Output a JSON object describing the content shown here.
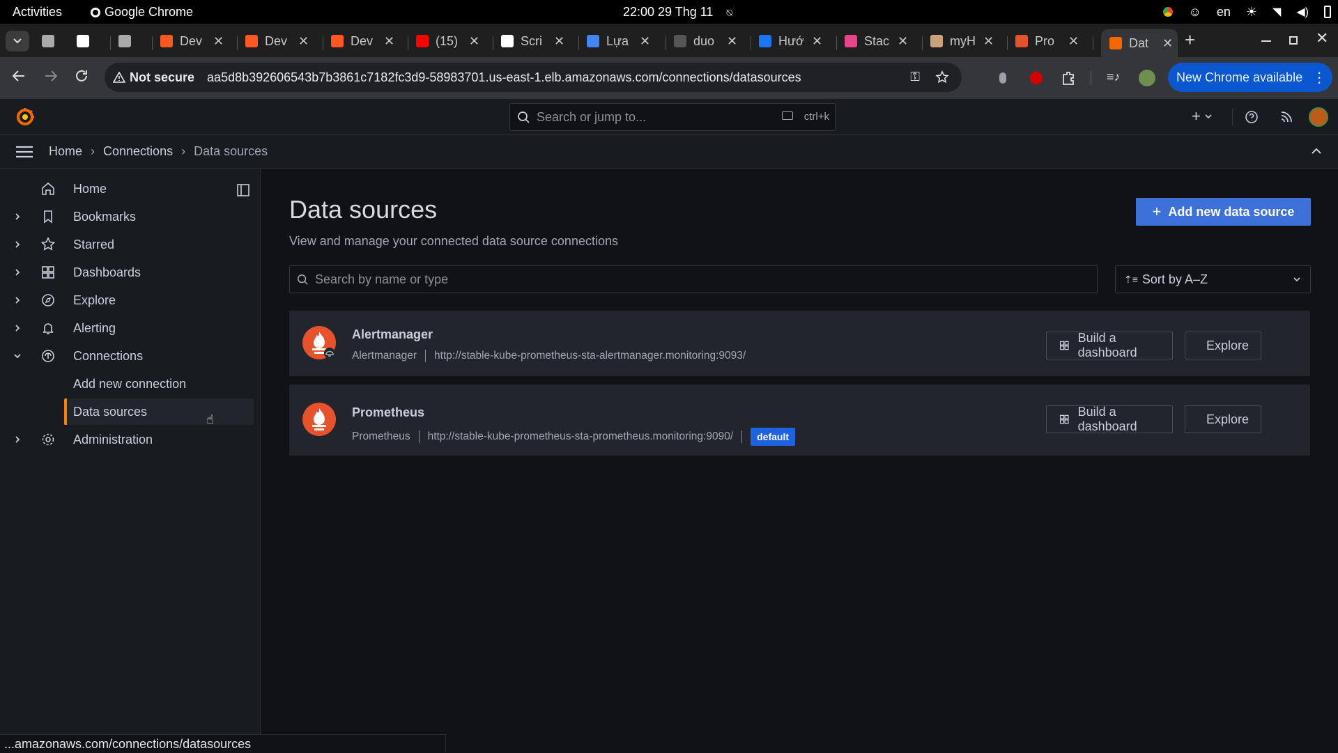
{
  "os": {
    "activities": "Activities",
    "app_name": "Google Chrome",
    "clock": "22:00  29 Thg 11",
    "lang": "en"
  },
  "tabs": [
    {
      "title": "",
      "color": "#aaaaaa"
    },
    {
      "title": "",
      "color": "#ffffff"
    },
    {
      "title": "",
      "color": "#aaaaaa"
    },
    {
      "title": "Dev",
      "color": "#ff5722"
    },
    {
      "title": "Dev",
      "color": "#ff5722"
    },
    {
      "title": "Dev",
      "color": "#ff5722"
    },
    {
      "title": "(15)",
      "color": "#ff0000"
    },
    {
      "title": "Scri",
      "color": "#ffffff"
    },
    {
      "title": "Lựa",
      "color": "#4285f4"
    },
    {
      "title": "duo",
      "color": "#555555"
    },
    {
      "title": "Hướ",
      "color": "#1877f2"
    },
    {
      "title": "Stac",
      "color": "#e8448a"
    },
    {
      "title": "myH",
      "color": "#c9a27a"
    },
    {
      "title": "Pro",
      "color": "#e6522c"
    },
    {
      "title": "Dat",
      "color": "#f46800"
    }
  ],
  "browser": {
    "not_secure": "Not secure",
    "url": "aa5d8b392606543b7b3861c7182fc3d9-58983701.us-east-1.elb.amazonaws.com/connections/datasources",
    "new_chrome": "New Chrome available"
  },
  "grafana": {
    "search_placeholder": "Search or jump to...",
    "search_shortcut": "ctrl+k",
    "breadcrumb": [
      "Home",
      "Connections",
      "Data sources"
    ],
    "nav": [
      {
        "label": "Home",
        "icon": "home-icon",
        "chevron": ""
      },
      {
        "label": "Bookmarks",
        "icon": "bookmark-icon",
        "chevron": "right"
      },
      {
        "label": "Starred",
        "icon": "star-icon",
        "chevron": "right"
      },
      {
        "label": "Dashboards",
        "icon": "apps-icon",
        "chevron": "right"
      },
      {
        "label": "Explore",
        "icon": "compass-icon",
        "chevron": "right"
      },
      {
        "label": "Alerting",
        "icon": "bell-icon",
        "chevron": "right"
      },
      {
        "label": "Connections",
        "icon": "connections-icon",
        "chevron": "down"
      },
      {
        "label": "Add new connection",
        "icon": "",
        "chevron": ""
      },
      {
        "label": "Data sources",
        "icon": "",
        "chevron": "",
        "active": true
      },
      {
        "label": "Administration",
        "icon": "cog-icon",
        "chevron": "right"
      }
    ],
    "page": {
      "title": "Data sources",
      "subtitle": "View and manage your connected data source connections",
      "add_button": "Add new data source",
      "filter_placeholder": "Search by name or type",
      "sort_label": "Sort by A–Z"
    },
    "datasources": [
      {
        "name": "Alertmanager",
        "type": "Alertmanager",
        "url": "http://stable-kube-prometheus-sta-alertmanager.monitoring:9093/",
        "default": "",
        "build_label": "Build a dashboard",
        "explore_label": "Explore"
      },
      {
        "name": "Prometheus",
        "type": "Prometheus",
        "url": "http://stable-kube-prometheus-sta-prometheus.monitoring:9090/",
        "default": "default",
        "build_label": "Build a dashboard",
        "explore_label": "Explore"
      }
    ]
  },
  "status_url": "...amazonaws.com/connections/datasources",
  "colors": {
    "accent": "#3d71d9",
    "active_nav": "#ff7f00",
    "prometheus": "#e6522c"
  }
}
